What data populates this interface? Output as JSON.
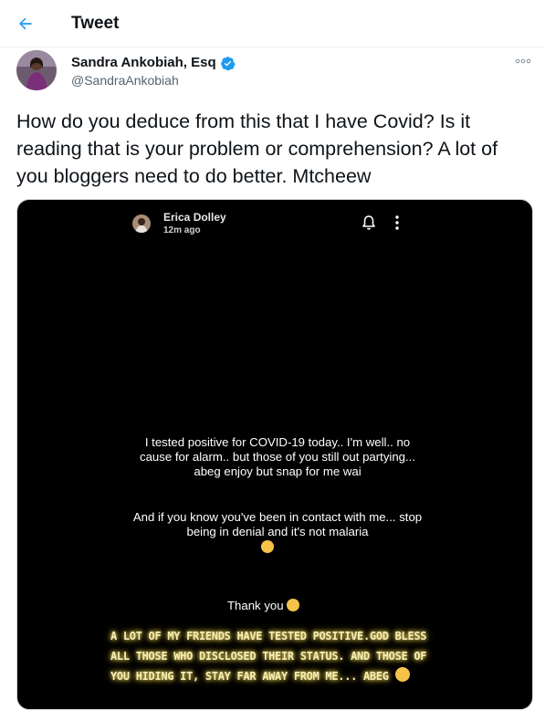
{
  "header": {
    "title": "Tweet",
    "back_icon": "arrow-left-icon",
    "accent": "#1d9bf0"
  },
  "tweet": {
    "author_name": "Sandra Ankobiah, Esq",
    "handle": "@SandraAnkobiah",
    "verified_icon": "verified-badge-icon",
    "more_icon": "more-horizontal-icon",
    "text": "How do you deduce from this that I have Covid? Is it reading that is your problem or comprehension? A lot of you bloggers need to do better. Mtcheew"
  },
  "media": {
    "story_user": "Erica Dolley",
    "story_time": "12m ago",
    "bell_icon": "bell-icon",
    "more_icon": "vertical-dots-icon",
    "paragraph_1": "I tested positive for COVID-19 today.. I'm well.. no cause for alarm.. but those of you still out partying... abeg enjoy but snap for me wai",
    "paragraph_2": "And if you know you've been in contact with me... stop being in denial and it's not malaria",
    "thanks": "Thank you",
    "caption_line_1": "A LOT OF MY FRIENDS HAVE TESTED POSITIVE.GOD BLESS",
    "caption_line_2": "ALL THOSE WHO DISCLOSED THEIR STATUS. AND THOSE OF",
    "caption_line_3": "YOU HIDING IT, STAY FAR AWAY FROM ME... ABEG"
  }
}
